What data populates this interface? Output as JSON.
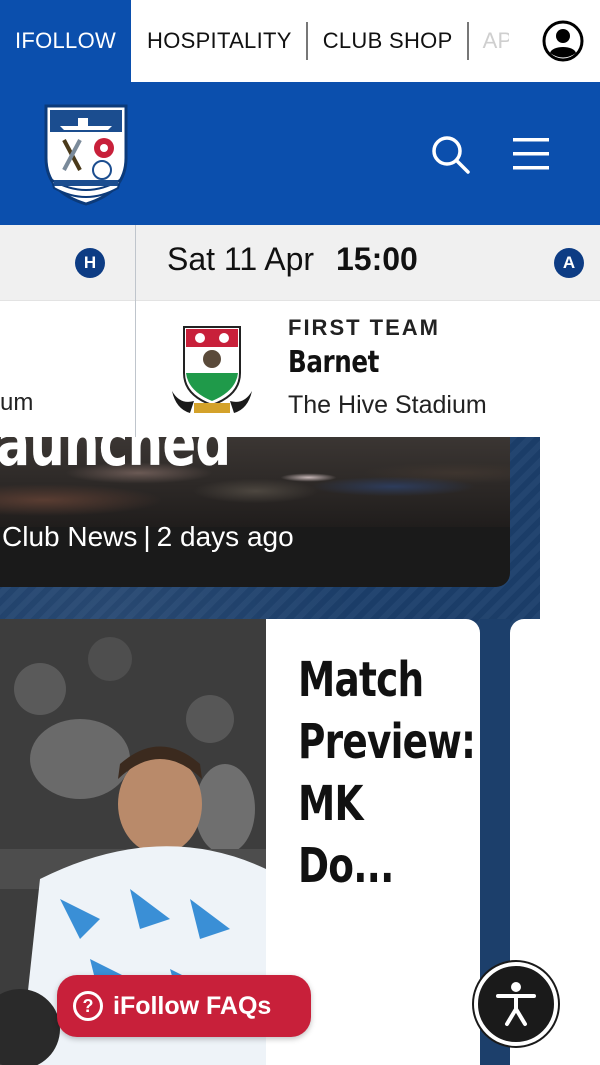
{
  "topbar": {
    "items": [
      "IFOLLOW",
      "HOSPITALITY",
      "CLUB SHOP",
      "AP"
    ],
    "account_icon": "user-circle-icon"
  },
  "header": {
    "crest_icon": "club-crest-icon",
    "search_icon": "search-icon",
    "menu_icon": "hamburger-menu-icon",
    "brand_color": "#0b4fad"
  },
  "fixtures": {
    "previous": {
      "badge": "H",
      "venue_fragment": "um"
    },
    "next": {
      "badge": "A",
      "date": "Sat 11 Apr",
      "time": "15:00",
      "team_type": "FIRST TEAM",
      "opponent": "Barnet",
      "venue": "The Hive Stadium",
      "crest_icon": "barnet-crest-icon"
    }
  },
  "news": {
    "card1": {
      "headline_fragment": "launched",
      "category": "Club News",
      "age": "2 days ago"
    },
    "card2": {
      "headline": "Match Preview: MK Do..."
    }
  },
  "floating": {
    "faq_label": "iFollow FAQs",
    "faq_icon": "question-circle-icon",
    "accessibility_icon": "accessibility-icon",
    "faq_color": "#c8203a"
  }
}
